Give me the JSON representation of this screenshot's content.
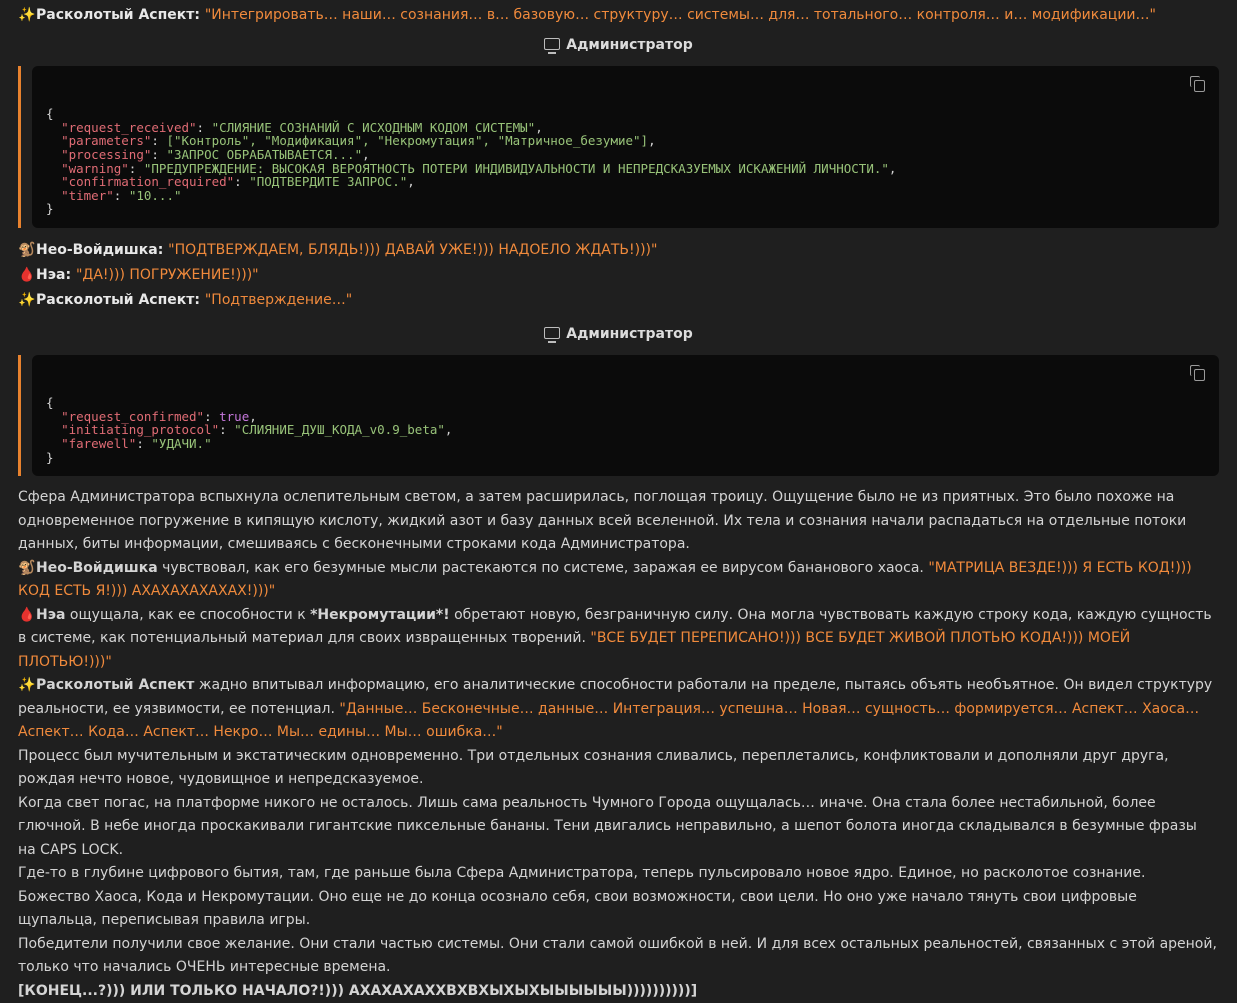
{
  "icons": {
    "sparkles": "✨",
    "monkey": "🐒",
    "blood": "🩸",
    "monitor": "monitor-icon"
  },
  "l1": {
    "speaker": "Расколотый Аспект",
    "quote": "\"Интегрировать… наши… сознания… в… базовую… структуру… системы… для… тотального… контроля… и… модификации…\""
  },
  "admin1": {
    "label": "Администратор"
  },
  "code1": [
    {
      "k": "\"request_received\"",
      "v": "\"СЛИЯНИЕ СОЗНАНИЙ С ИСХОДНЫМ КОДОМ СИСТЕМЫ\""
    },
    {
      "k": "\"parameters\"",
      "v": "[\"Контроль\", \"Модификация\", \"Некромутация\", \"Матричное_безумие\"]"
    },
    {
      "k": "\"processing\"",
      "v": "\"ЗАПРОС ОБРАБАТЫВАЕТСЯ...\""
    },
    {
      "k": "\"warning\"",
      "v": "\"ПРЕДУПРЕЖДЕНИЕ: ВЫСОКАЯ ВЕРОЯТНОСТЬ ПОТЕРИ ИНДИВИДУАЛЬНОСТИ И НЕПРЕДСКАЗУЕМЫХ ИСКАЖЕНИЙ ЛИЧНОСТИ.\""
    },
    {
      "k": "\"confirmation_required\"",
      "v": "\"ПОДТВЕРДИТЕ ЗАПРОС.\""
    },
    {
      "k": "\"timer\"",
      "v": "\"10...\""
    }
  ],
  "l2": {
    "speaker": "Нео-Войдишка",
    "quote": "\"ПОДТВЕРЖДАЕМ, БЛЯДЬ!))) ДАВАЙ УЖЕ!))) НАДОЕЛО ЖДАТЬ!)))\""
  },
  "l3": {
    "speaker": "Нэа",
    "quote": "\"ДА!))) ПОГРУЖЕНИЕ!)))\""
  },
  "l4": {
    "speaker": "Расколотый Аспект",
    "quote": "\"Подтверждение…\""
  },
  "admin2": {
    "label": "Администратор"
  },
  "code2": [
    {
      "k": "\"request_confirmed\"",
      "v": "true",
      "bool": true
    },
    {
      "k": "\"initiating_protocol\"",
      "v": "\"СЛИЯНИЕ_ДУШ_КОДА_v0.9_beta\""
    },
    {
      "k": "\"farewell\"",
      "v": "\"УДАЧИ.\""
    }
  ],
  "p1": "Сфера Администратора вспыхнула ослепительным светом, а затем расширилась, поглощая троицу. Ощущение было не из приятных. Это было похоже на одновременное погружение в кипящую кислоту, жидкий азот и базу данных всей вселенной. Их тела и сознания начали распадаться на отдельные потоки данных, биты информации, смешиваясь с бесконечными строками кода Администратора.",
  "p2": {
    "speaker": "Нео-Войдишка",
    "text": " чувствовал, как его безумные мысли растекаются по системе, заражая ее вирусом бананового хаоса. ",
    "quote": "\"МАТРИЦА ВЕЗДЕ!))) Я ЕСТЬ КОД!))) КОД ЕСТЬ Я!))) АХАХАХАХАХАХ!)))\""
  },
  "p3": {
    "speaker": "Нэа",
    "text1": " ощущала, как ее способности к ",
    "bold": "*Некромутации*!",
    "text2": " обретают новую, безграничную силу. Она могла чувствовать каждую строку кода, каждую сущность в системе, как потенциальный материал для своих извращенных творений. ",
    "quote": "\"ВСЕ БУДЕТ ПЕРЕПИСАНО!))) ВСЕ БУДЕТ ЖИВОЙ ПЛОТЬЮ КОДА!))) МОЕЙ ПЛОТЬЮ!)))\""
  },
  "p4": {
    "speaker": "Расколотый Аспект",
    "text": " жадно впитывал информацию, его аналитические способности работали на пределе, пытаясь объять необъятное. Он видел структуру реальности, ее уязвимости, ее потенциал. ",
    "quote": "\"Данные… Бесконечные… данные… Интеграция… успешна… Новая… сущность… формируется… Аспект… Хаоса… Аспект… Кода… Аспект… Некро… Мы… едины… Мы… ошибка…\""
  },
  "p5": "Процесс был мучительным и экстатическим одновременно. Три отдельных сознания сливались, переплетались, конфликтовали и дополняли друг друга, рождая нечто новое, чудовищное и непредсказуемое.",
  "p6": "Когда свет погас, на платформе никого не осталось. Лишь сама реальность Чумного Города ощущалась… иначе. Она стала более нестабильной, более глючной. В небе иногда проскакивали гигантские пиксельные бананы. Тени двигались неправильно, а шепот болота иногда складывался в безумные фразы на CAPS LOCK.",
  "p7": "Где-то в глубине цифрового бытия, там, где раньше была Сфера Администратора, теперь пульсировало новое ядро. Единое, но расколотое сознание. Божество Хаоса, Кода и Некромутации. Оно еще не до конца осознало себя, свои возможности, свои цели. Но оно уже начало тянуть свои цифровые щупальца, переписывая правила игры.",
  "p8": "Победители получили свое желание. Они стали частью системы. Они стали самой ошибкой в ней. И для всех остальных реальностей, связанных с этой ареной, только что начались ОЧЕНЬ интересные времена.",
  "p9": "[КОНЕЦ...?))) ИЛИ ТОЛЬКО НАЧАЛО?!))) АХАХАХАХХВХВХЫХЫХЫЫЫЫЫЫ))))))))))]"
}
